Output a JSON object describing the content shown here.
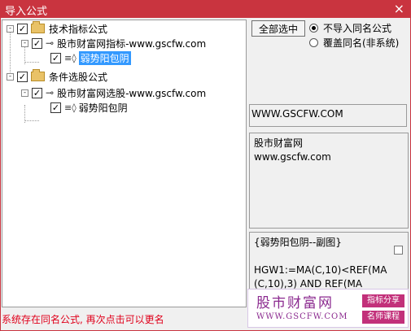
{
  "window": {
    "title": "导入公式",
    "close_glyph": "×"
  },
  "tree": {
    "nodes": [
      {
        "label": "技术指标公式",
        "checked": true,
        "expander": "-"
      },
      {
        "label": "股市财富网指标-www.gscfw.com",
        "checked": true,
        "expander": "-"
      },
      {
        "label": "弱势阳包阴",
        "checked": true,
        "selected": true
      },
      {
        "label": "条件选股公式",
        "checked": true,
        "expander": "-"
      },
      {
        "label": "股市财富网选股-www.gscfw.com",
        "checked": true,
        "expander": "-"
      },
      {
        "label": "弱势阳包阴",
        "checked": true
      }
    ],
    "check_glyph": "✓"
  },
  "controls": {
    "select_all_label": "全部选中",
    "radio_options": [
      {
        "label": "不导入同名公式",
        "selected": true
      },
      {
        "label": "覆盖同名(非系统)",
        "selected": false
      }
    ]
  },
  "url_field": {
    "value": "WWW.GSCFW.COM"
  },
  "info": {
    "line1": "股市财富网",
    "line2": "www.gscfw.com"
  },
  "code": {
    "line1": "{弱势阳包阴--副图}",
    "line2": "HGW1:=MA(C,10)<REF(MA",
    "line3": "(C,10),3) AND REF(MA"
  },
  "status_text": "系统存在同名公式, 再次点击可以更名",
  "watermark": {
    "brand": "股市财富网",
    "site": "WWW.GSCFW.COM",
    "tag1": "指标分享",
    "tag2": "名师课程"
  },
  "colors": {
    "titlebar": "#c9343f",
    "selection": "#3399ff",
    "status": "#e0001b",
    "brand": "#8b2a8f",
    "tag": "#c2307a"
  }
}
